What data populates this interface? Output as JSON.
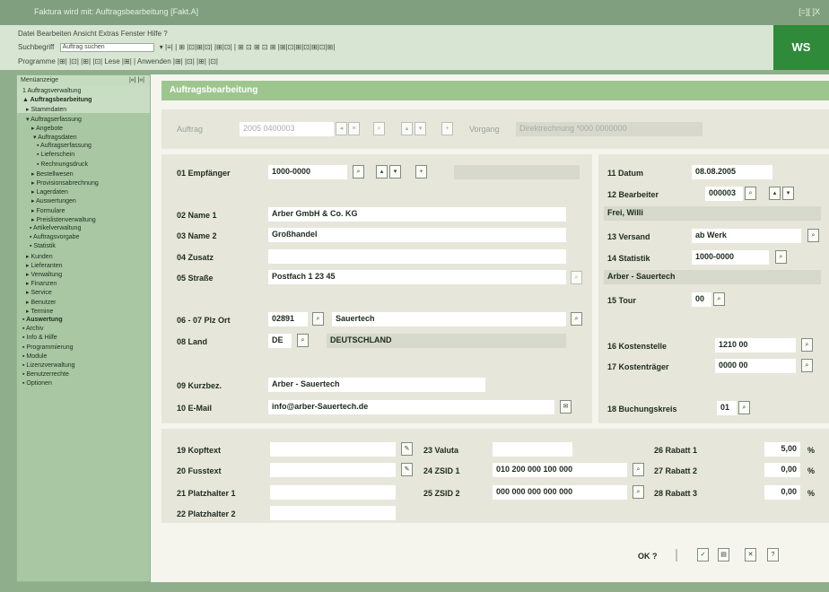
{
  "window": {
    "title": "Faktura wird mit: Auftragsbearbeitung [Fakt.A]",
    "controls": "[=][ ]X"
  },
  "menubar": {
    "row1": "Datei  Bearbeiten  Ansicht  Extras  Fenster  Hilfe  ?",
    "row2_label": "Suchbegriff",
    "row2_value": "Auftrag suchen",
    "row2_rest": "▾ |≡| |  ⊞ |⊡|⊞|⊡| |⊞|⊡| |  ⊞ ⊡ ⊞ ⊡ ⊞  |⊞|⊡|⊞|⊡|⊞|⊡|⊞|",
    "row3": "Programme |⊞| |⊡| |⊞| |⊡|    Lese |⊞|  |  Anwenden |⊞| |⊡| |⊞| |⊡|",
    "brand": "WS"
  },
  "sidebar": {
    "header": "Menüanzeige",
    "header_ctl": "|«| |»|",
    "items": [
      {
        "label": "1 Auftragsverwaltung",
        "bold": false
      },
      {
        "label": "▲ Auftragsbearbeitung",
        "bold": true
      },
      {
        "label": "▸ Stammdaten",
        "bold": false
      },
      {
        "label": "▾ Auftragserfassung",
        "bold": false
      },
      {
        "label": "▸ Angebote",
        "bold": false
      },
      {
        "label": "▾ Auftragsdaten",
        "bold": false
      },
      {
        "label": "▪ Auftragserfassung",
        "bold": false
      },
      {
        "label": "▪ Lieferschein",
        "bold": false
      },
      {
        "label": "▪ Rechnungsdruck",
        "bold": false
      },
      {
        "label": "▸ Bestellwesen",
        "bold": false
      },
      {
        "label": "▸ Provisionsabrechnung",
        "bold": false
      },
      {
        "label": "▸ Lagerdaten",
        "bold": false
      },
      {
        "label": "▸ Auswertungen",
        "bold": false
      },
      {
        "label": "▸ Formulare",
        "bold": false
      },
      {
        "label": "▸ Preislistenverwaltung",
        "bold": false
      },
      {
        "label": "▪ Artikelverwaltung",
        "bold": false
      },
      {
        "label": "▪ Auftragsvorgabe",
        "bold": false
      },
      {
        "label": "▪ Statistik",
        "bold": false
      },
      {
        "label": "▸ Kunden",
        "bold": false
      },
      {
        "label": "▸ Lieferanten",
        "bold": false
      },
      {
        "label": "▸ Verwaltung",
        "bold": false
      },
      {
        "label": "▸ Finanzen",
        "bold": false
      },
      {
        "label": "▸ Service",
        "bold": false
      },
      {
        "label": "▸ Benutzer",
        "bold": false
      },
      {
        "label": "▸ Termine",
        "bold": false
      },
      {
        "label": "▪ Auswertung",
        "bold": true
      },
      {
        "label": "▪ Archiv",
        "bold": false
      },
      {
        "label": "▪ Info & Hilfe",
        "bold": false
      },
      {
        "label": "▪ Programmierung",
        "bold": false
      },
      {
        "label": "▪ Module",
        "bold": false
      },
      {
        "label": "▪ Lizenzverwaltung",
        "bold": false
      },
      {
        "label": "▪ Benutzerrechte",
        "bold": false
      },
      {
        "label": "▪ Optionen",
        "bold": false
      }
    ]
  },
  "main": {
    "title": "Auftragsbearbeitung",
    "top": {
      "auftrag_label": "Auftrag",
      "auftrag_value": "2005 0400003",
      "vorgang_label": "Vorgang",
      "vorgang_value": "Direktrechnung *000 0000000"
    },
    "left": {
      "empfaenger_label": "01 Empfänger",
      "empfaenger_value": "1000-0000",
      "name1_label": "02 Name 1",
      "name1_value": "Arber GmbH & Co. KG",
      "name2_label": "03 Name 2",
      "name2_value": "Großhandel",
      "zusatz_label": "04 Zusatz",
      "zusatz_value": "",
      "strasse_label": "05 Straße",
      "strasse_value": "Postfach 1 23 45",
      "plzort_label": "06 - 07 Plz Ort",
      "plz_value": "02891",
      "ort_value": "Sauertech",
      "land_label": "08 Land",
      "land_code": "DE",
      "land_name": "DEUTSCHLAND",
      "kurzbez_label": "09 Kurzbez.",
      "kurzbez_value": "Arber - Sauertech",
      "email_label": "10 E-Mail",
      "email_value": "info@arber-Sauertech.de"
    },
    "right": {
      "datum_label": "11 Datum",
      "datum_value": "08.08.2005",
      "bearbeiter_label": "12 Bearbeiter",
      "bearbeiter_value": "000003",
      "bearbeiter_name": "Frei, Willi",
      "versand_label": "13 Versand",
      "versand_value": "ab Werk",
      "statistik_label": "14 Statistik",
      "statistik_value": "1000-0000",
      "statistik_name": "Arber - Sauertech",
      "tour_label": "15 Tour",
      "tour_value": "00",
      "kostenstelle_label": "16 Kostenstelle",
      "kostenstelle_value": "1210 00",
      "kostentraeger_label": "17 Kostenträger",
      "kostentraeger_value": "0000 00",
      "buchungskreis_label": "18 Buchungskreis",
      "buchungskreis_value": "01"
    },
    "bottom": {
      "kopftext_label": "19 Kopftext",
      "fusstext_label": "20 Fusstext",
      "platzhalter1_label": "21 Platzhalter 1",
      "platzhalter2_label": "22 Platzhalter 2",
      "valuta_label": "23 Valuta",
      "zsid1_label": "24 ZSID 1",
      "zsid1_value": "010 200 000 100 000",
      "zsid2_label": "25 ZSID 2",
      "zsid2_value": "000 000 000 000 000",
      "rabatt1_label": "26 Rabatt 1",
      "rabatt1_value": "5,00",
      "rabatt2_label": "27 Rabatt 2",
      "rabatt2_value": "0,00",
      "rabatt3_label": "28 Rabatt 3",
      "rabatt3_value": "0,00",
      "percent": "%"
    },
    "footer": {
      "ok_label": "OK ?"
    }
  }
}
